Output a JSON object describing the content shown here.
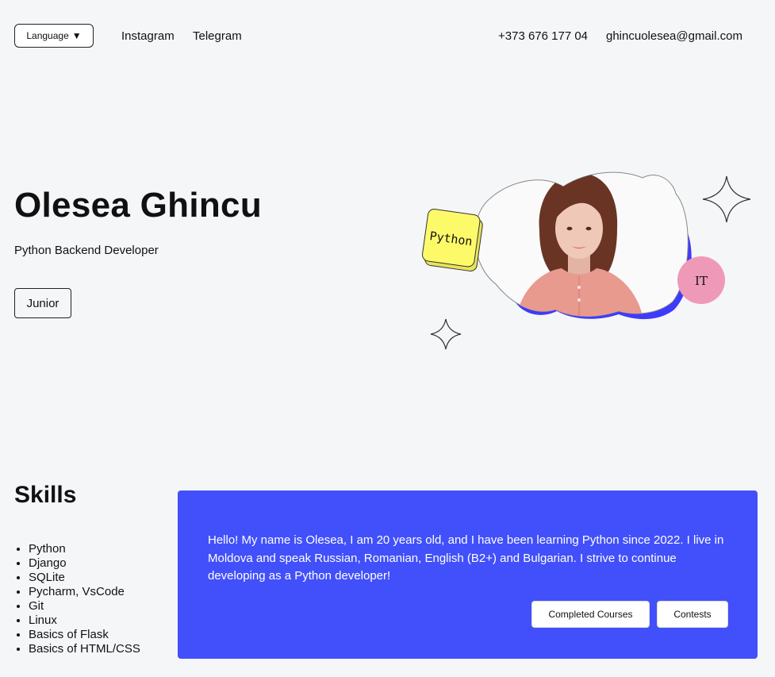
{
  "header": {
    "language_label": "Language",
    "language_arrow": "▼",
    "nav": [
      "Instagram",
      "Telegram"
    ],
    "phone": "+373 676 177 04",
    "email": "ghincuolesea@gmail.com"
  },
  "hero": {
    "name": "Olesea Ghincu",
    "role": "Python Backend Developer",
    "level": "Junior",
    "sticker_python": "Python",
    "badge_it": "IT"
  },
  "skills": {
    "title": "Skills",
    "items": [
      "Python",
      "Django",
      "SQLite",
      "Pycharm, VsCode",
      "Git",
      "Linux",
      "Basics of Flask",
      "Basics of HTML/CSS"
    ]
  },
  "about": {
    "text": "Hello! My name is Olesea, I am 20 years old, and I have been learning Python since 2022. I live in Moldova and speak Russian, Romanian, English (B2+) and Bulgarian. I strive to continue developing as a Python developer!",
    "buttons": {
      "courses": "Completed Courses",
      "contests": "Contests"
    }
  },
  "colors": {
    "page_bg": "#f5f6f8",
    "accent_blue": "#4150fb",
    "sticker_yellow": "#fdfa6a",
    "badge_pink": "#ef99b8"
  }
}
